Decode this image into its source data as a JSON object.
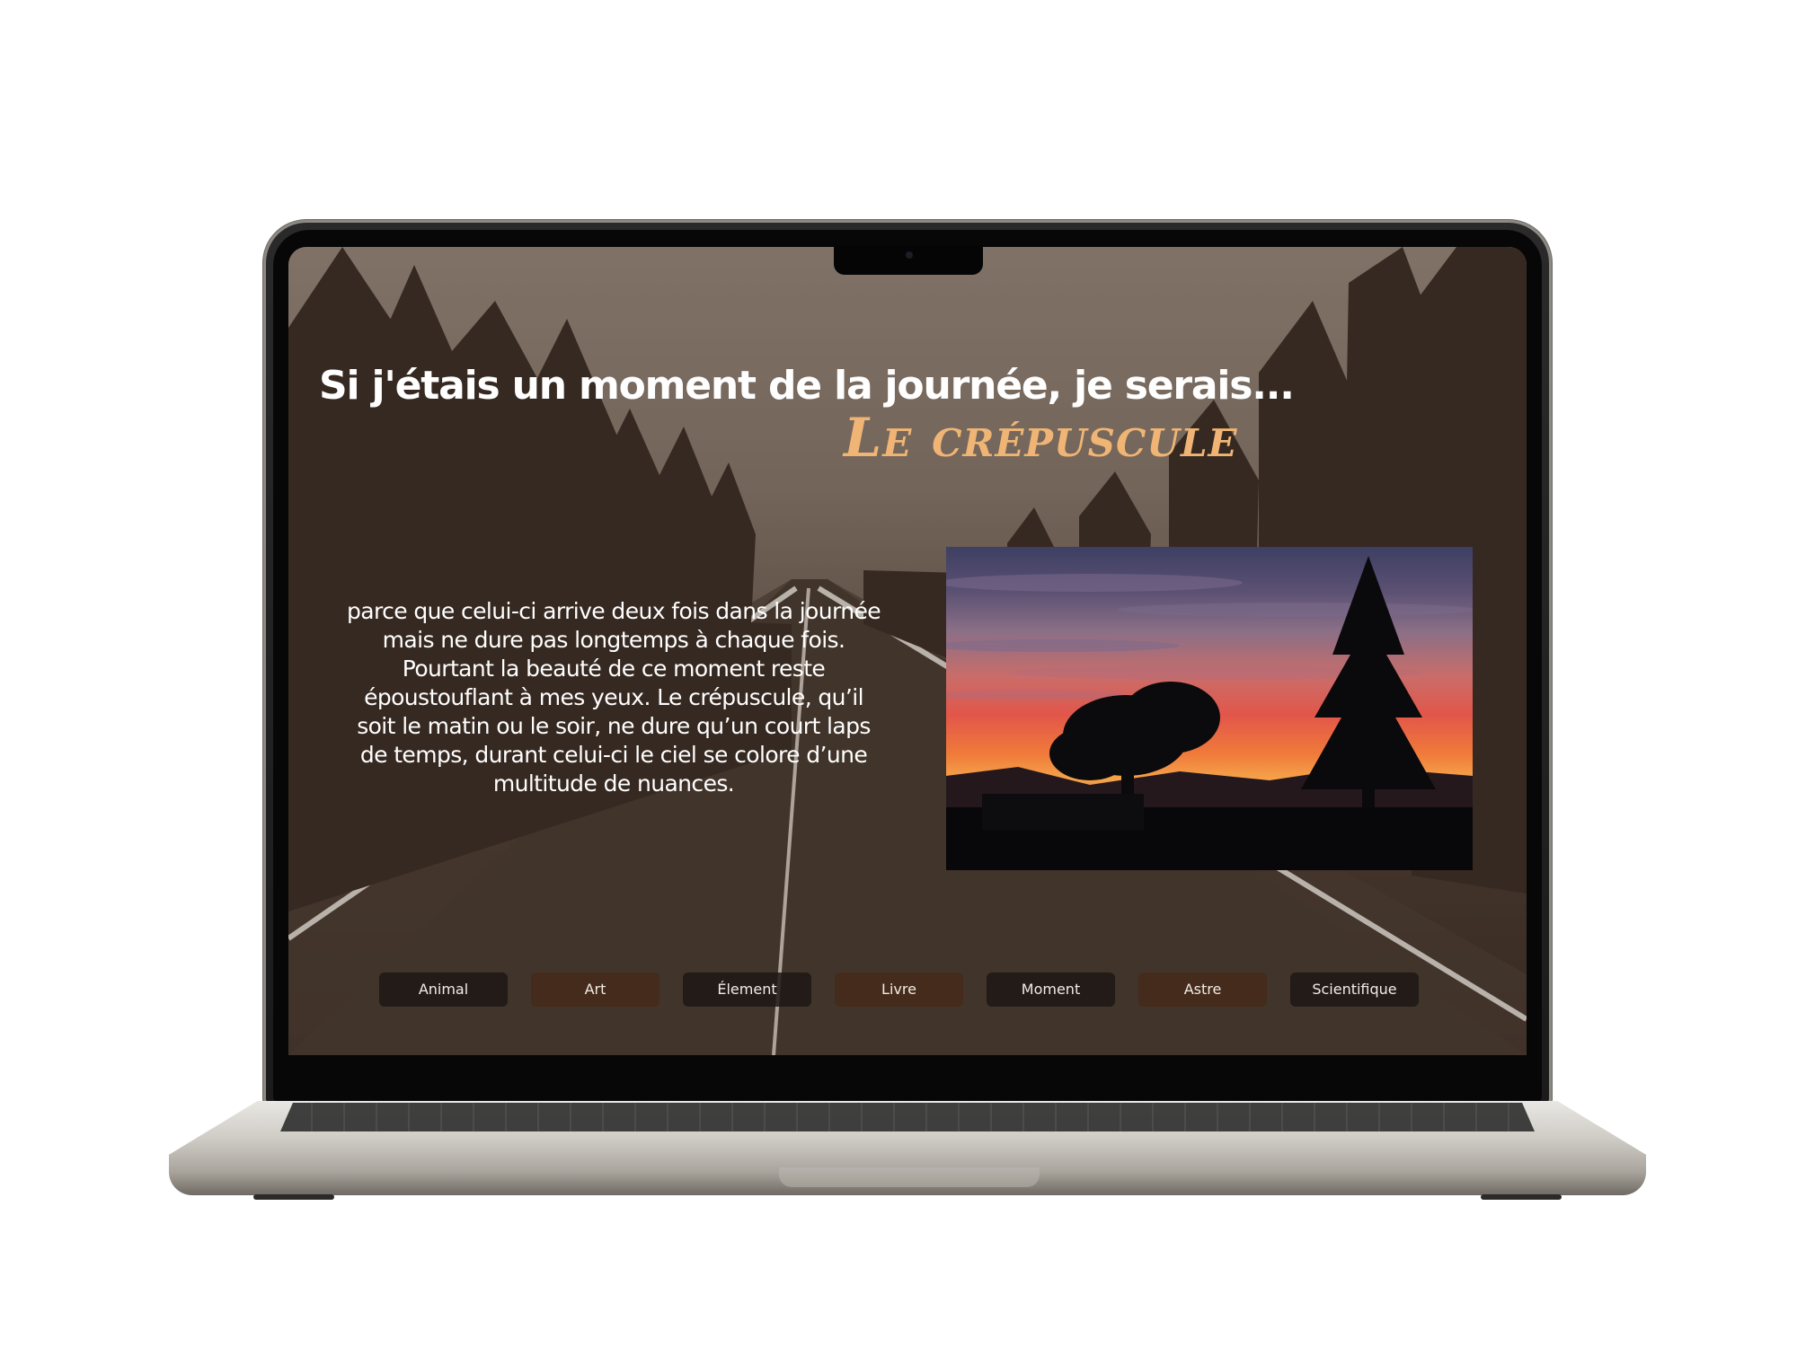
{
  "page": {
    "headline": "Si j'étais un moment de la journée, je serais...",
    "subject": "Le crépuscule",
    "body": "parce que celui-ci arrive deux fois dans la journée mais ne dure pas longtemps à chaque fois. Pourtant la beauté de ce moment reste époustouflant à mes yeux. Le crépuscule, qu’il soit le matin ou le soir, ne dure qu’un court laps de temps, durant celui-ci le ciel se colore d’une multitude de nuances."
  },
  "nav": {
    "items": [
      {
        "label": "Animal",
        "style": "dark"
      },
      {
        "label": "Art",
        "style": "brown"
      },
      {
        "label": "Élement",
        "style": "dark"
      },
      {
        "label": "Livre",
        "style": "brown"
      },
      {
        "label": "Moment",
        "style": "dark"
      },
      {
        "label": "Astre",
        "style": "brown"
      },
      {
        "label": "Scientifique",
        "style": "dark"
      }
    ]
  },
  "colors": {
    "subject_accent": "#f0b575",
    "button_dark": "#1e1814",
    "button_brown": "#462a19",
    "background_sepia": "#4a3b31"
  }
}
